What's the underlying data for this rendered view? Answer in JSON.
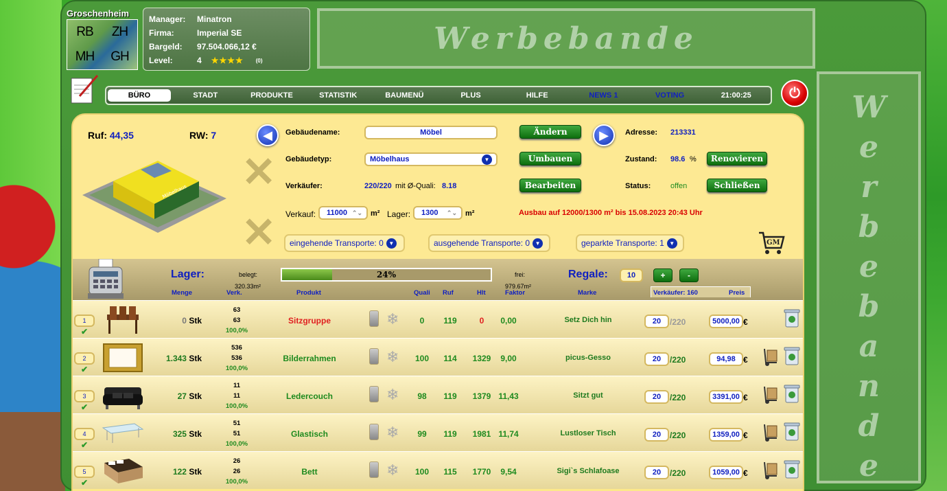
{
  "city": {
    "name": "Groschenheim",
    "map_labels": [
      "RB",
      "ZH",
      "MH",
      "GH"
    ]
  },
  "info": {
    "rows": [
      {
        "k": "Manager:",
        "v": "Minatron"
      },
      {
        "k": "Firma:",
        "v": "Imperial SE"
      },
      {
        "k": "Bargeld:",
        "v": "97.504.066,12 €"
      }
    ],
    "level_label": "Level:",
    "level_value": "4",
    "stars": "★★★★",
    "stars_count": "(0)"
  },
  "ads": {
    "top": "Werbebande",
    "side": [
      "W",
      "e",
      "r",
      "b",
      "e",
      "b",
      "a",
      "n",
      "d",
      "e"
    ]
  },
  "nav": {
    "items": [
      "BÜRO",
      "STADT",
      "PRODUKTE",
      "STATISTIK",
      "BAUMENÜ",
      "PLUS",
      "HILFE",
      "NEWS 1",
      "VOTING",
      "21:00:25"
    ],
    "active_index": 0
  },
  "building": {
    "ruf_label": "Ruf:",
    "ruf_value": "44,35",
    "rw_label": "RW:",
    "rw_value": "7",
    "name_label": "Gebäudename:",
    "name_value": "Möbel",
    "type_label": "Gebäudetyp:",
    "type_value": "Möbelhaus",
    "seller_label": "Verkäufer:",
    "seller_value": "220/220",
    "seller_mit": "mit Ø-Quali:",
    "seller_quali": "8.18",
    "verkauf_label": "Verkauf:",
    "verkauf_value": "11000",
    "unit_m2": "m²",
    "lager_label": "Lager:",
    "lager_value": "1300",
    "ausbau_text": "Ausbau auf 12000/1300 m² bis 15.08.2023 20:43 Uhr",
    "address_label": "Adresse:",
    "address_value": "213331",
    "state_label": "Zustand:",
    "state_value": "98.6",
    "state_unit": "%",
    "status_label": "Status:",
    "status_value": "offen",
    "btn_change": "Ändern",
    "btn_rebuild": "Umbauen",
    "btn_edit": "Bearbeiten",
    "btn_renovate": "Renovieren",
    "btn_close": "Schließen",
    "transport_in": "eingehende Transporte: 0",
    "transport_out": "ausgehende Transporte: 0",
    "transport_parked": "geparkte Transporte: 1",
    "building_sign": "Möbelhaus",
    "cart_label": "GM"
  },
  "lager": {
    "title": "Lager:",
    "belegt_label": "belegt:",
    "belegt_value": "320.33m²",
    "fill_pct": 24,
    "fill_text": "24%",
    "frei_label": "frei:",
    "frei_value": "979.67m²",
    "regale_label": "Regale:",
    "regale_value": "10",
    "plus": "+",
    "minus": "-",
    "columns": {
      "menge": "Menge",
      "verk": "Verk.",
      "produkt": "Produkt",
      "quali": "Quali",
      "ruf": "Ruf",
      "hlt": "Hlt",
      "faktor": "Faktor",
      "marke": "Marke",
      "verkaeufer": "Verkäufer: 160",
      "preis": "Preis"
    }
  },
  "rows": [
    {
      "n": "1",
      "menge": "0",
      "stk": "Stk",
      "v1": "63",
      "v2": "63",
      "pct": "100,0%",
      "produkt": "Sitzgruppe",
      "produkt_red": true,
      "quali": "0",
      "ruf": "119",
      "hlt": "0",
      "hlt_red": true,
      "faktor": "0,00",
      "marke": "Setz Dich hin",
      "vk": "20",
      "vk_max": "/220",
      "vk_grey": true,
      "preis": "5000,00",
      "eur": "€",
      "truck": false
    },
    {
      "n": "2",
      "menge": "1.343",
      "stk": "Stk",
      "v1": "536",
      "v2": "536",
      "pct": "100,0%",
      "produkt": "Bilderrahmen",
      "produkt_red": false,
      "quali": "100",
      "ruf": "114",
      "hlt": "1329",
      "hlt_red": false,
      "faktor": "9,00",
      "marke": "picus-Gesso",
      "vk": "20",
      "vk_max": "/220",
      "vk_grey": false,
      "preis": "94,98",
      "eur": "€",
      "truck": true
    },
    {
      "n": "3",
      "menge": "27",
      "stk": "Stk",
      "v1": "11",
      "v2": "11",
      "pct": "100,0%",
      "produkt": "Ledercouch",
      "produkt_red": false,
      "quali": "98",
      "ruf": "119",
      "hlt": "1379",
      "hlt_red": false,
      "faktor": "11,43",
      "marke": "Sitzt gut",
      "vk": "20",
      "vk_max": "/220",
      "vk_grey": false,
      "preis": "3391,00",
      "eur": "€",
      "truck": true
    },
    {
      "n": "4",
      "menge": "325",
      "stk": "Stk",
      "v1": "51",
      "v2": "51",
      "pct": "100,0%",
      "produkt": "Glastisch",
      "produkt_red": false,
      "quali": "99",
      "ruf": "119",
      "hlt": "1981",
      "hlt_red": false,
      "faktor": "11,74",
      "marke": "Lustloser Tisch",
      "vk": "20",
      "vk_max": "/220",
      "vk_grey": false,
      "preis": "1359,00",
      "eur": "€",
      "truck": true
    },
    {
      "n": "5",
      "menge": "122",
      "stk": "Stk",
      "v1": "26",
      "v2": "26",
      "pct": "100,0%",
      "produkt": "Bett",
      "produkt_red": false,
      "quali": "100",
      "ruf": "115",
      "hlt": "1770",
      "hlt_red": false,
      "faktor": "9,54",
      "marke": "Sigi`s Schlafoase",
      "vk": "20",
      "vk_max": "/220",
      "vk_grey": false,
      "preis": "1059,00",
      "eur": "€",
      "truck": true
    }
  ]
}
